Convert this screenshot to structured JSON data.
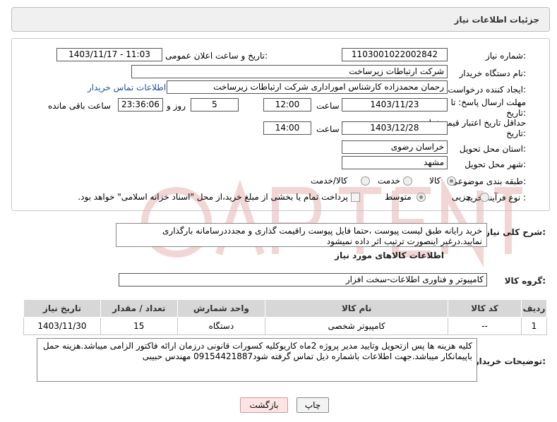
{
  "page_title": "جزئیات اطلاعات نیاز",
  "fields": {
    "need_number_label": "شماره نیاز:",
    "need_number": "1103001022002842",
    "announce_label": "تاریخ و ساعت اعلان عمومی:",
    "announce_value": "1403/11/17 - 11:03",
    "buyer_org_label": "نام دستگاه خریدار:",
    "buyer_org": "شرکت ارتباطات زیرساخت",
    "creator_label": "ایجاد کننده درخواست:",
    "creator": "رحمان محمدزاده کارشناس امورادارى  شرکت ارتباطات زیرساخت",
    "contact_link": "اطلاعات تماس خریدار",
    "deadline_label": "مهلت ارسال پاسخ: تا",
    "deadline_label2": "تاریخ:",
    "deadline_date": "1403/11/23",
    "time_label": "ساعت",
    "deadline_time": "12:00",
    "days_value": "5",
    "days_label": "روز و",
    "remaining_time": "23:36:06",
    "remaining_label": "ساعت باقی مانده",
    "validity_label": "حداقل تاریخ اعتبار قیمت: تا",
    "validity_label2": "تاریخ:",
    "validity_date": "1403/12/28",
    "validity_time": "14:00",
    "province_label": "استان محل تحویل:",
    "province": "خراسان رضوی",
    "city_label": "شهر محل تحویل:",
    "city": "مشهد",
    "category_label": "طبقه بندی موضوعی:",
    "category_options": [
      "کالا",
      "خدمت",
      "کالا/خدمت"
    ],
    "process_label": "نوع فرآیند خرید :",
    "process_options": [
      "جزیی",
      "متوسط"
    ],
    "payment_note": "پرداخت تمام یا بخشی از مبلغ خرید،از محل \"اسناد خزانه اسلامی\" خواهد بود."
  },
  "description": {
    "label": "شرح کلی نیاز:",
    "text": "خرید رایانه طبق لیست پیوست ،حتما فایل پیوست راقیمت گذاری و مجدددرسامانه بارگذاری نمایید.درغیر اینصورت ترتیب اثر داده نمیشود"
  },
  "goods_section_title": "اطلاعات کالاهای مورد نیاز",
  "goods_group_label": "گروه کالا:",
  "goods_group": "کامپیوتر و فناوری اطلاعات-سخت افزار",
  "table": {
    "headers": [
      "ردیف",
      "کد کالا",
      "نام کالا",
      "واحد شمارش",
      "تعداد / مقدار",
      "تاریخ نیاز"
    ],
    "rows": [
      [
        "1",
        "--",
        "کامپیوتر شخصی",
        "دستگاه",
        "15",
        "1403/11/30"
      ]
    ]
  },
  "buyer_notes": {
    "label": "توضیحات خریدار:",
    "text": "کلیه هزینه ها پس ازتحویل وتایید مدیر پروژه 2ماه کاریوکلیه کسورات قانونی درزمان ارائه فاکتور الزامی میباشد.هزینه حمل باپیمانکار میباشد.جهت اطلاعات باشماره ذیل تماس گرفته شود09154421887 مهندس حبیبی"
  },
  "buttons": {
    "print": "چاپ",
    "back": "بازگشت"
  },
  "colors": {
    "link": "#1a4f9c",
    "header_bg": "#d7d7d7",
    "back_button_bg": "#fde4e4"
  }
}
